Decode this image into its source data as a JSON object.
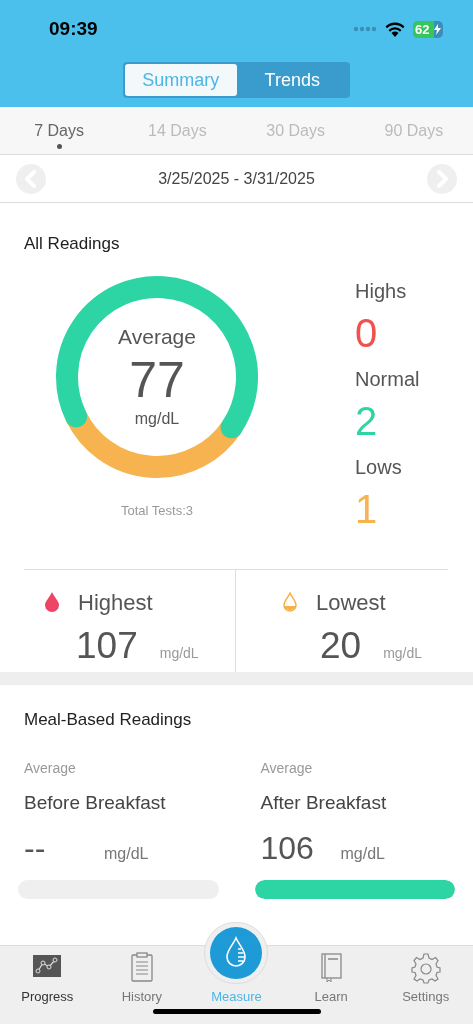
{
  "status_bar": {
    "time": "09:39",
    "battery": "62"
  },
  "view_tabs": [
    {
      "label": "Summary",
      "selected": true
    },
    {
      "label": "Trends",
      "selected": false
    }
  ],
  "period_tabs": [
    {
      "label": "7 Days",
      "selected": true
    },
    {
      "label": "14 Days",
      "selected": false
    },
    {
      "label": "30 Days",
      "selected": false
    },
    {
      "label": "90 Days",
      "selected": false
    }
  ],
  "date_range": "3/25/2025 - 3/31/2025",
  "all_readings": {
    "title": "All Readings",
    "average_label": "Average",
    "average": "77",
    "unit": "mg/dL",
    "total_tests": "Total Tests:3",
    "counts": [
      {
        "label": "Highs",
        "value": "0",
        "color": "#f0524f"
      },
      {
        "label": "Normal",
        "value": "2",
        "color": "#2dd4a4"
      },
      {
        "label": "Lows",
        "value": "1",
        "color": "#f7b350"
      }
    ]
  },
  "extremes": [
    {
      "kind": "high",
      "label": "Highest",
      "value": "107",
      "unit": "mg/dL"
    },
    {
      "kind": "low",
      "label": "Lowest",
      "value": "20",
      "unit": "mg/dL"
    }
  ],
  "meal_readings": {
    "title": "Meal-Based Readings",
    "items": [
      {
        "caption": "Average",
        "meal": "Before Breakfast",
        "value": "--",
        "unit": "mg/dL",
        "level": 0
      },
      {
        "caption": "Average",
        "meal": "After Breakfast",
        "value": "106",
        "unit": "mg/dL",
        "level": 1
      }
    ]
  },
  "tab_bar": [
    {
      "kind": "progress",
      "label": "Progress",
      "selected": false
    },
    {
      "kind": "history",
      "label": "History",
      "selected": false
    },
    {
      "kind": "measure",
      "label": "Measure",
      "selected": true
    },
    {
      "kind": "learn",
      "label": "Learn",
      "selected": false
    },
    {
      "kind": "settings",
      "label": "Settings",
      "selected": false
    }
  ]
}
